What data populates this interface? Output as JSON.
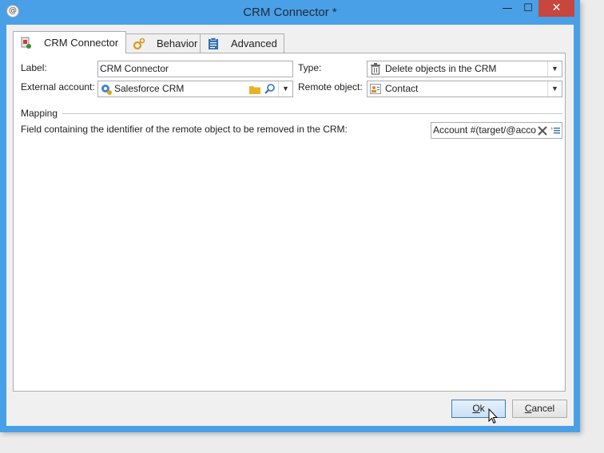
{
  "window": {
    "title": "CRM Connector *",
    "controls": {
      "minimize": "—",
      "maximize": "☐",
      "close": "✕"
    }
  },
  "tabs": [
    {
      "label": "CRM Connector",
      "icon": "crm-connector-icon",
      "active": true
    },
    {
      "label": "Behavior",
      "icon": "gear-icon",
      "active": false
    },
    {
      "label": "Advanced",
      "icon": "clipboard-icon",
      "active": false
    }
  ],
  "form": {
    "label_caption": "Label:",
    "label_value": "CRM Connector",
    "external_account_caption": "External account:",
    "external_account_value": "Salesforce CRM",
    "type_caption": "Type:",
    "type_value": "Delete objects in the CRM",
    "remote_object_caption": "Remote object:",
    "remote_object_value": "Contact"
  },
  "mapping": {
    "section_title": "Mapping",
    "field_caption": "Field containing the identifier of the remote object to be removed in the CRM:",
    "field_value": "Account #(target/@acco"
  },
  "buttons": {
    "ok_label": "Ok",
    "ok_mnemonic_rest": "k",
    "ok_mnemonic": "O",
    "cancel_mnemonic": "C",
    "cancel_rest": "ancel"
  },
  "colors": {
    "titlebar": "#4aa0e6",
    "close_button": "#c7463d",
    "panel_background": "#ffffff"
  }
}
